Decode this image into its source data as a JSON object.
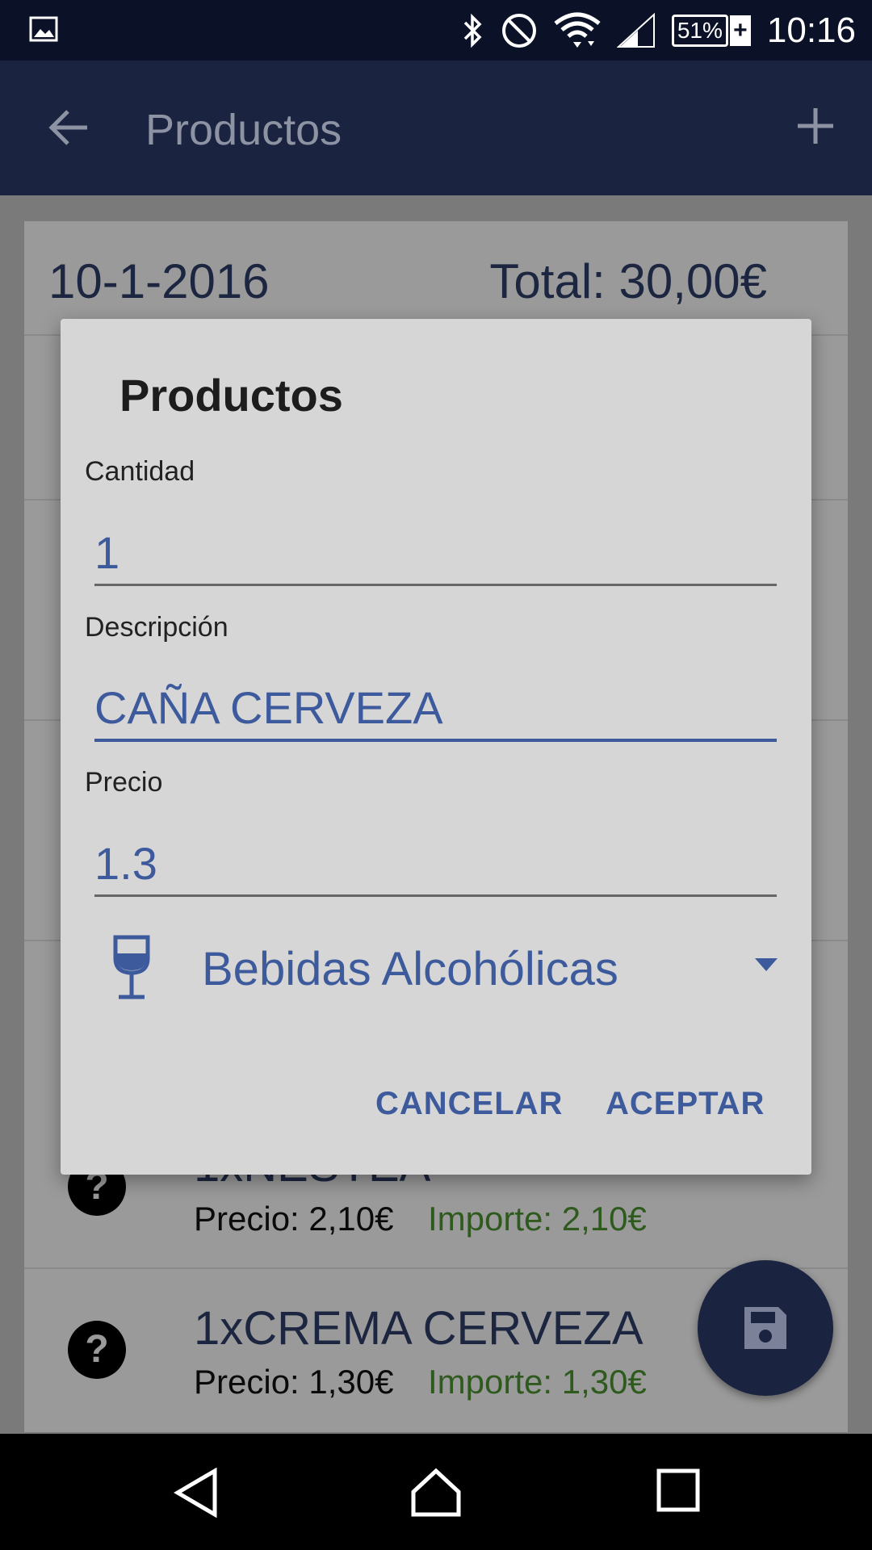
{
  "status_bar": {
    "time": "10:16",
    "battery": "51%",
    "icons": [
      "image-icon",
      "bluetooth-icon",
      "do-not-disturb-icon",
      "wifi-icon",
      "signal-icon",
      "battery-charging-icon"
    ]
  },
  "app_bar": {
    "title": "Productos",
    "back_icon": "back-arrow-icon",
    "add_icon": "add-icon"
  },
  "list": {
    "date": "10-1-2016",
    "total": "Total: 30,00€",
    "items": [
      {
        "name": "1xNESTEA",
        "price": "Precio: 2,10€",
        "importe": "Importe: 2,10€"
      },
      {
        "name": "1xCREMA CERVEZA",
        "price": "Precio: 1,30€",
        "importe": "Importe: 1,30€"
      }
    ]
  },
  "dialog": {
    "title": "Productos",
    "cantidad_label": "Cantidad",
    "cantidad_value": "1",
    "descripcion_label": "Descripción",
    "descripcion_value": "CAÑA CERVEZA",
    "precio_label": "Precio",
    "precio_value": "1.3",
    "category_selected": "Bebidas Alcohólicas",
    "cancel_label": "CANCELAR",
    "accept_label": "ACEPTAR"
  },
  "colors": {
    "accent": "#3d5a9c",
    "primary_dark": "#1a2340",
    "importe_green": "#2f5a1e"
  }
}
